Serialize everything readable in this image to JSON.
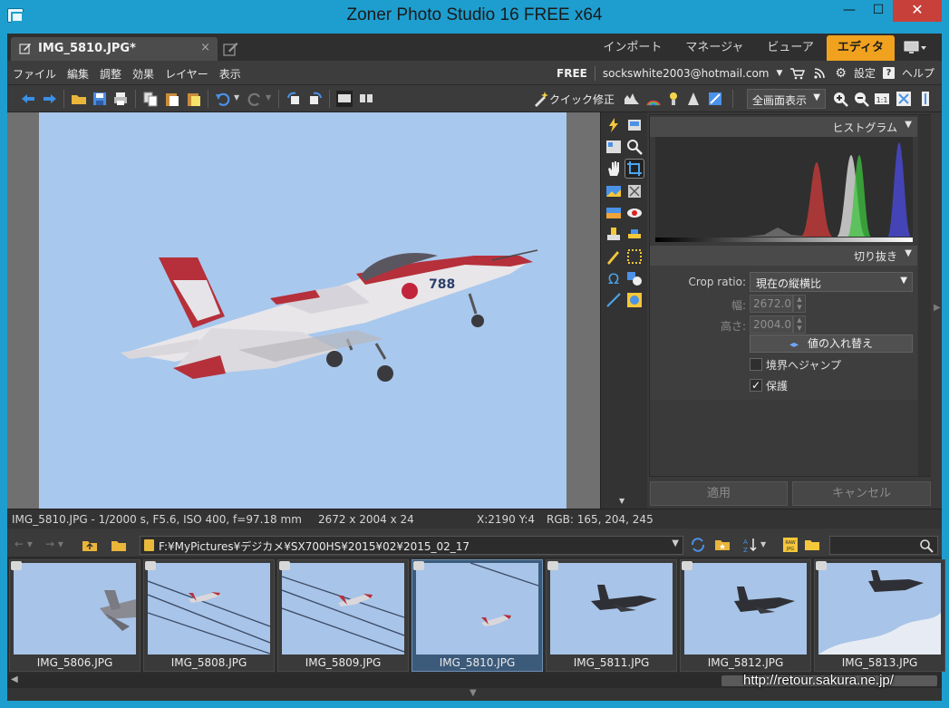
{
  "window": {
    "title": "Zoner Photo Studio 16 FREE x64",
    "min_glyph": "—",
    "max_glyph": "☐",
    "close_glyph": "✕"
  },
  "tabs": {
    "document": "IMG_5810.JPG*",
    "close_glyph": "×",
    "modes": [
      {
        "label": "インポート"
      },
      {
        "label": "マネージャ"
      },
      {
        "label": "ビューア"
      },
      {
        "label": "エディタ"
      }
    ],
    "active_mode": "エディタ"
  },
  "menu": {
    "items": [
      "ファイル",
      "編集",
      "調整",
      "効果",
      "レイヤー",
      "表示"
    ],
    "free": "FREE",
    "account": "sockswhite2003@hotmail.com",
    "settings": "設定",
    "help": "ヘルプ"
  },
  "toolbar": {
    "quick_fix": "クイック修正",
    "view_mode": "全画面表示"
  },
  "histogram_panel": {
    "title": "ヒストグラム"
  },
  "crop_panel": {
    "title": "切り抜き",
    "ratio_label": "Crop ratio:",
    "ratio_value": "現在の縦横比",
    "width_label": "幅:",
    "width_value": "2672.0",
    "height_label": "高さ:",
    "height_value": "2004.0",
    "swap_button": "値の入れ替え",
    "jump_label": "境界へジャンプ",
    "jump_checked": false,
    "protect_label": "保護",
    "protect_checked": true
  },
  "actions": {
    "apply": "適用",
    "cancel": "キャンセル"
  },
  "status": {
    "exif": "IMG_5810.JPG - 1/2000 s, F5.6, ISO 400, f=97.18 mm",
    "dimensions": "2672 x 2004 x 24",
    "coords": "X:2190 Y:4",
    "rgb": "RGB: 165, 204, 245"
  },
  "browser": {
    "path": "F:¥MyPictures¥デジカメ¥SX700HS¥2015¥02¥2015_02_17"
  },
  "thumbnails": [
    {
      "name": "IMG_5806.JPG"
    },
    {
      "name": "IMG_5808.JPG"
    },
    {
      "name": "IMG_5809.JPG"
    },
    {
      "name": "IMG_5810.JPG"
    },
    {
      "name": "IMG_5811.JPG"
    },
    {
      "name": "IMG_5812.JPG"
    },
    {
      "name": "IMG_5813.JPG"
    }
  ],
  "selected_thumbnail": "IMG_5810.JPG",
  "watermark": "http://retour.sakura.ne.jp/",
  "colors": {
    "title_bar": "#1e9ecf",
    "active_mode_tab": "#f0a21e",
    "sky": "#a9c8ee",
    "jet_red": "#b5303a"
  }
}
